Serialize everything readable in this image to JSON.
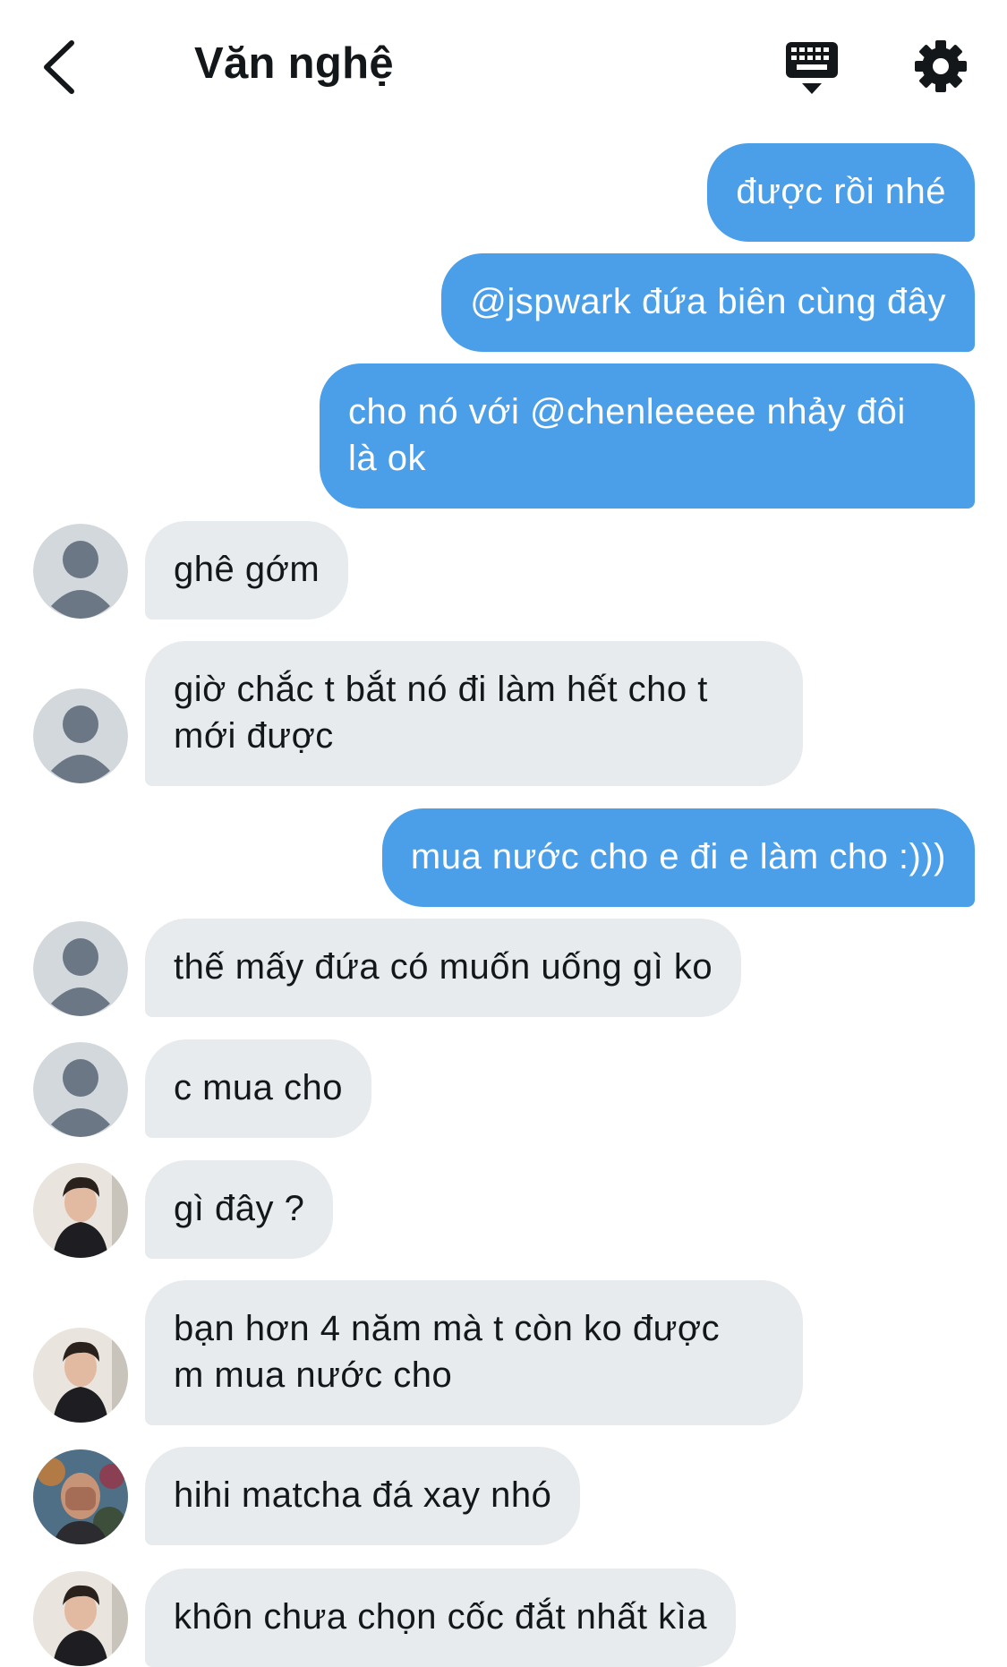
{
  "header": {
    "title": "Văn nghệ",
    "back_icon": "chevron-left-icon",
    "keyboard_icon": "keyboard-icon",
    "settings_icon": "gear-icon"
  },
  "colors": {
    "outgoing_bubble": "#4a9fe8",
    "incoming_bubble": "#e8ebee",
    "text_dark": "#14171a"
  },
  "messages": [
    {
      "dir": "out",
      "text": "được rồi nhé"
    },
    {
      "dir": "out",
      "text": "@jspwark đứa biên cùng đây"
    },
    {
      "dir": "out",
      "text": "cho nó với @chenleeeee nhảy đôi\nlà ok"
    },
    {
      "dir": "in",
      "avatar": "default-avatar",
      "text": "ghê gớm"
    },
    {
      "dir": "in",
      "avatar": "default-avatar",
      "text": "giờ chắc t bắt nó đi làm hết cho t\nmới được"
    },
    {
      "dir": "out",
      "text": "mua nước cho e đi e làm cho :)))"
    },
    {
      "dir": "in",
      "avatar": "default-avatar",
      "text": "thế mấy đứa có muốn uống gì ko"
    },
    {
      "dir": "in",
      "avatar": "default-avatar",
      "text": "c mua cho"
    },
    {
      "dir": "in",
      "avatar": "photo-avatar-a",
      "text": "gì đây ?"
    },
    {
      "dir": "in",
      "avatar": "photo-avatar-a",
      "text": "bạn hơn 4 năm mà t còn ko được\nm mua nước cho"
    },
    {
      "dir": "in",
      "avatar": "photo-avatar-b",
      "text": "hihi matcha đá xay nhó"
    },
    {
      "dir": "in",
      "avatar": "photo-avatar-a",
      "text": "khôn chưa chọn cốc đắt nhất kìa"
    }
  ]
}
